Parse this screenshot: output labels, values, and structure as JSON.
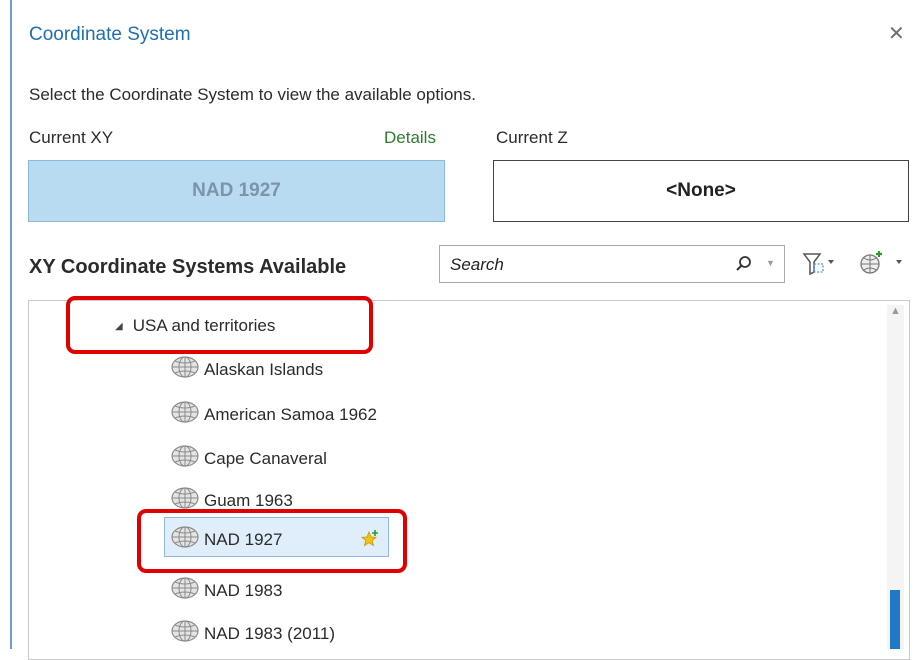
{
  "dialog": {
    "title": "Coordinate System",
    "close_icon": "close-icon",
    "instruction": "Select the Coordinate System to view the available options."
  },
  "current_xy": {
    "label": "Current XY",
    "details_link": "Details",
    "value": "NAD 1927"
  },
  "current_z": {
    "label": "Current Z",
    "value": "<None>"
  },
  "available": {
    "heading": "XY Coordinate Systems Available",
    "search_placeholder": "Search",
    "search_icon": "search-icon",
    "filter_icon": "filter-icon",
    "add_globe_icon": "add-coordinate-system-icon"
  },
  "tree": {
    "group": {
      "label": "USA and territories",
      "expanded": true
    },
    "items": [
      {
        "label": "Alaskan Islands"
      },
      {
        "label": "American Samoa 1962"
      },
      {
        "label": "Cape Canaveral"
      },
      {
        "label": "Guam 1963"
      },
      {
        "label": "NAD 1927",
        "selected": true,
        "favorite": true
      },
      {
        "label": "NAD 1983"
      },
      {
        "label": "NAD 1983 (2011)"
      }
    ]
  },
  "colors": {
    "title": "#1f6fb2",
    "details": "#2e7d2e",
    "xy_box_fill": "#b8dbf1",
    "selection_fill": "#dfeefa",
    "highlight": "#e00000",
    "scroll_thumb": "#1f78c8"
  }
}
